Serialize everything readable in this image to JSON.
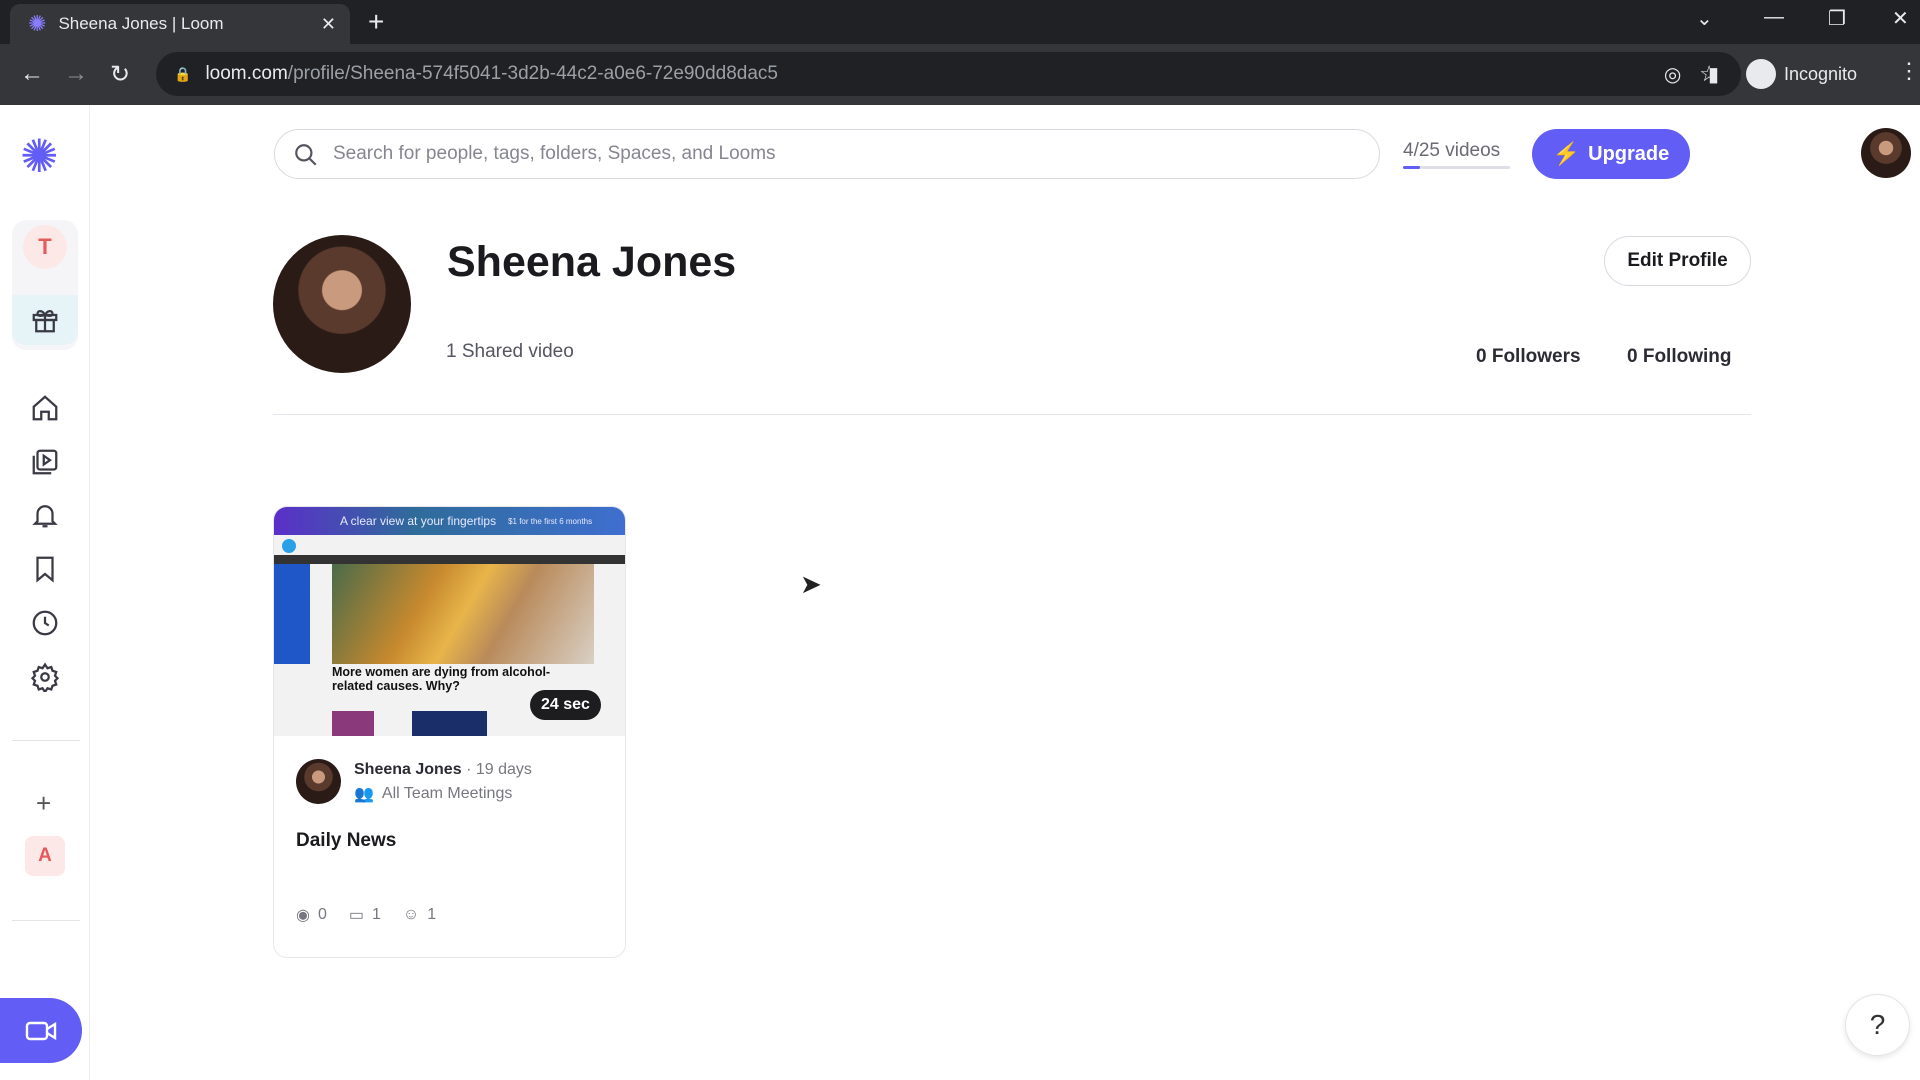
{
  "browser": {
    "tab_title": "Sheena Jones | Loom",
    "url_domain": "loom.com",
    "url_path": "/profile/Sheena-574f5041-3d2b-44c2-a0e6-72e90dd8dac5",
    "incognito_label": "Incognito"
  },
  "sidebar": {
    "workspace_letter": "T",
    "bottom_letter": "A",
    "plus": "+",
    "items": [
      "home-icon",
      "library-icon",
      "bell-icon",
      "bookmark-icon",
      "clock-icon",
      "gear-icon"
    ]
  },
  "header": {
    "search_placeholder": "Search for people, tags, folders, Spaces, and Looms",
    "quota": "4/25 videos",
    "quota_fraction": 0.16,
    "upgrade_label": "Upgrade"
  },
  "profile": {
    "name": "Sheena Jones",
    "shared": "1 Shared video",
    "edit_label": "Edit Profile",
    "followers": "0 Followers",
    "following": "0 Following"
  },
  "video": {
    "banner": "A clear view at your fingertips",
    "banner_offer": "$1 for the first 6 months",
    "headline": "More women are dying from alcohol-related causes. Why?",
    "duration": "24 sec",
    "author": "Sheena Jones",
    "age": "· 19 days",
    "space": "All Team Meetings",
    "title": "Daily News",
    "views": "0",
    "comments": "1",
    "reactions": "1"
  },
  "help": "?",
  "colors": {
    "accent": "#625df5"
  }
}
